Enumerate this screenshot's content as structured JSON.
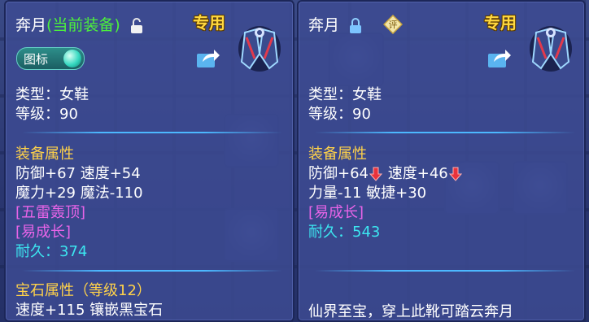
{
  "left_panel": {
    "name": "奔月",
    "equipped_tag": "(当前装备)",
    "exclusive": "专用",
    "badge_label": "图标",
    "type_line": "类型：女鞋",
    "level_line": "等级：90",
    "attr_header": "装备属性",
    "attr_line1": "防御+67 速度+54",
    "attr_line2": "魔力+29 魔法-110",
    "special_skill": "[五雷轰顶]",
    "special_effect": "[易成长]",
    "durability_label": "耐久：",
    "durability_value": "374",
    "gem_header": "宝石属性（等级12）",
    "gem_line": "速度+115 镶嵌黑宝石"
  },
  "right_panel": {
    "name": "奔月",
    "exclusive": "专用",
    "rate_badge": "评",
    "type_line": "类型：女鞋",
    "level_line": "等级：90",
    "attr_header": "装备属性",
    "attr_def": "防御+64",
    "attr_spd": "速度+46",
    "attr_line2": "力量-11 敏捷+30",
    "special_effect": "[易成长]",
    "durability_label": "耐久：",
    "durability_value": "543",
    "description": "仙界至宝，穿上此靴可踏云奔月"
  },
  "colors": {
    "title_white": "#ffffff",
    "equipped_green": "#4cf03c",
    "exclusive_gold": "#ffd840",
    "section_yellow": "#ffd24a",
    "special_magenta": "#e864e8",
    "durability_cyan": "#3ce6f0",
    "decrease_red": "#e8323c"
  },
  "icons": {
    "lock_open": "unlock-icon",
    "lock_closed": "lock-icon",
    "share": "share-icon",
    "item": "boots-item-icon",
    "down_arrow": "red-down-arrow-icon"
  }
}
